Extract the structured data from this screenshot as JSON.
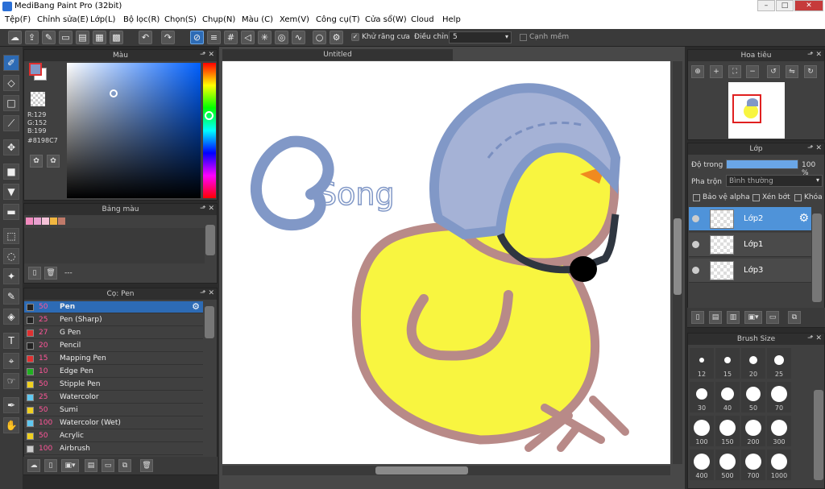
{
  "window": {
    "title": "MediBang Paint Pro (32bit)",
    "minimize": "–",
    "maximize": "□",
    "close": "✕"
  },
  "menu": [
    "Tệp(F)",
    "Chỉnh sửa(E)",
    "Lớp(L)",
    "Bộ lọc(R)",
    "Chọn(S)",
    "Chụp(N)",
    "Màu (C)",
    "Xem(V)",
    "Công cụ(T)",
    "Cửa sổ(W)",
    "Cloud",
    "Help"
  ],
  "toolbar": {
    "antialias_label": "Khử răng cưa",
    "adjust_label": "Điều chỉnh",
    "adjust_value": "5",
    "smooth_label": "Cạnh mềm"
  },
  "color_panel": {
    "title": "Màu",
    "r": "R:129",
    "g": "G:152",
    "b": "B:199",
    "hex": "#8198C7",
    "fg": "#8198C7",
    "bg": "#ffffff"
  },
  "palette_panel": {
    "title": "Bảng màu",
    "swatches": [
      "#f28bbf",
      "#e8a0d0",
      "#f5c2d8",
      "#f2b640",
      "#c07a6a"
    ],
    "dash": "---"
  },
  "brush_panel": {
    "title": "Cọ: Pen",
    "items": [
      {
        "size": "50",
        "name": "Pen",
        "color": "#222222"
      },
      {
        "size": "25",
        "name": "Pen (Sharp)",
        "color": "#222222"
      },
      {
        "size": "27",
        "name": "G Pen",
        "color": "#e03030"
      },
      {
        "size": "20",
        "name": "Pencil",
        "color": "#222222"
      },
      {
        "size": "15",
        "name": "Mapping Pen",
        "color": "#e03030"
      },
      {
        "size": "10",
        "name": "Edge Pen",
        "color": "#20b020"
      },
      {
        "size": "50",
        "name": "Stipple Pen",
        "color": "#f0d020"
      },
      {
        "size": "25",
        "name": "Watercolor",
        "color": "#60c8f0"
      },
      {
        "size": "50",
        "name": "Sumi",
        "color": "#f0d020"
      },
      {
        "size": "100",
        "name": "Watercolor (Wet)",
        "color": "#60c8f0"
      },
      {
        "size": "50",
        "name": "Acrylic",
        "color": "#f0d020"
      },
      {
        "size": "100",
        "name": "Airbrush",
        "color": "#cccccc"
      }
    ]
  },
  "canvas": {
    "title": "Untitled"
  },
  "navigator": {
    "title": "Hoa tiêu"
  },
  "layer_panel": {
    "title": "Lớp",
    "opacity_label": "Độ trong",
    "opacity_value": "100 %",
    "opacity_fraction": 1.0,
    "blend_label": "Pha trộn",
    "blend_value": "Bình thường",
    "protect_alpha": "Bảo vệ alpha",
    "clipping": "Xén bớt",
    "lock": "Khóa",
    "layers": [
      "Lớp2",
      "Lớp1",
      "Lớp3"
    ]
  },
  "brush_size_panel": {
    "title": "Brush Size",
    "sizes": [
      "12",
      "15",
      "20",
      "25",
      "30",
      "40",
      "50",
      "70",
      "100",
      "150",
      "200",
      "300",
      "400",
      "500",
      "700",
      "1000"
    ]
  }
}
